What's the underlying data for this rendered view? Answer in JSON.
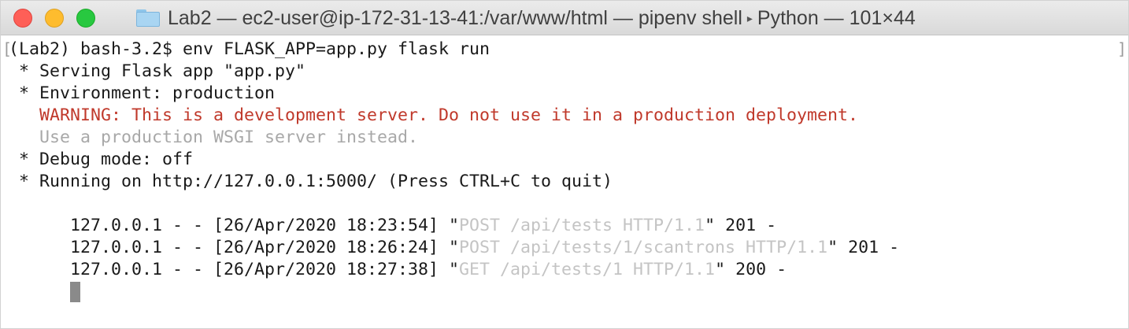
{
  "window": {
    "title_prefix": "Lab2 — ec2-user@ip-172-31-13-41:/var/www/html — pipenv shell",
    "title_separator_icon": "▸",
    "title_suffix": "Python — 101×44",
    "folder_icon": "folder-icon",
    "scroll_left": "[",
    "scroll_right": "]"
  },
  "terminal": {
    "prompt": "(Lab2) bash-3.2$ env FLASK_APP=app.py flask run",
    "serving": " * Serving Flask app \"app.py\"",
    "environment": " * Environment: production",
    "warning": "   WARNING: This is a development server. Do not use it in a production deployment.",
    "wsgi_hint": "   Use a production WSGI server instead.",
    "debug": " * Debug mode: off",
    "running": " * Running on http://127.0.0.1:5000/ (Press CTRL+C to quit)",
    "log": [
      {
        "prefix": "127.0.0.1 - - [26/Apr/2020 18:23:54] \"",
        "request": "POST /api/tests HTTP/1.1",
        "suffix": "\" 201 -"
      },
      {
        "prefix": "127.0.0.1 - - [26/Apr/2020 18:26:24] \"",
        "request": "POST /api/tests/1/scantrons HTTP/1.1",
        "suffix": "\" 201 -"
      },
      {
        "prefix": "127.0.0.1 - - [26/Apr/2020 18:27:38] \"",
        "request": "GET /api/tests/1 HTTP/1.1",
        "suffix": "\" 200 -"
      }
    ]
  },
  "colors": {
    "warning": "#c0392b",
    "dim_text": "#a8a8a8",
    "request_text": "#c4c4c4",
    "close": "#fe5f57",
    "minimize": "#febc2e",
    "maximize": "#28c840"
  }
}
